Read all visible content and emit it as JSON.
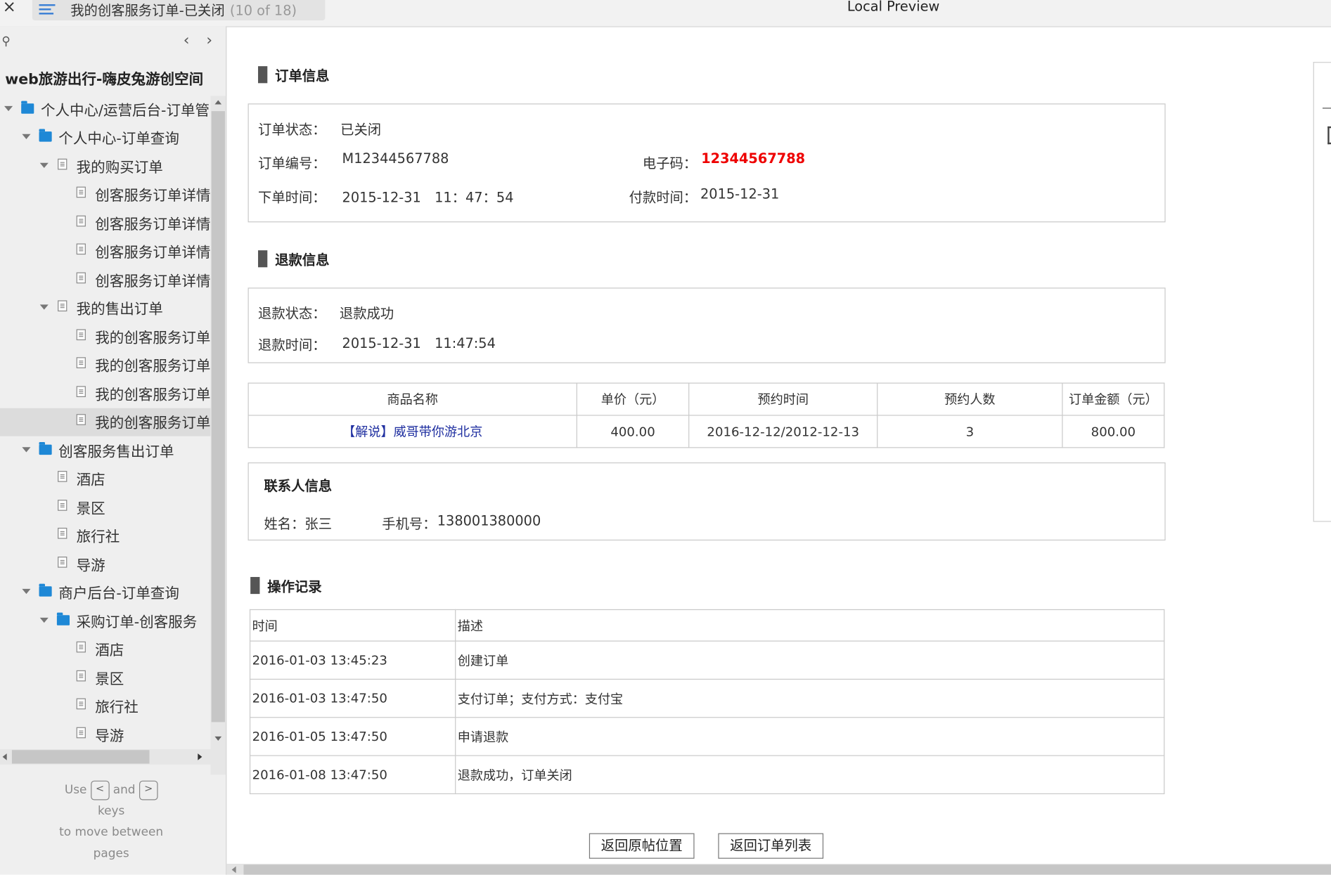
{
  "topbar": {
    "close_glyph": "×",
    "tab_title": "我的创客服务订单-已关闭",
    "tab_count": "(10 of 18)",
    "preview_title": "Local Preview"
  },
  "sidebar": {
    "search_glyph": "⚲",
    "prev_glyph": "‹",
    "next_glyph": "›",
    "project_title": "web旅游出行-嗨皮兔游创空间",
    "tree": [
      {
        "label": "个人中心/运营后台-订单管",
        "type": "folder",
        "expanded": true
      },
      {
        "label": "个人中心-订单查询",
        "type": "folder",
        "expanded": true
      },
      {
        "label": "我的购买订单",
        "type": "page",
        "expanded": true
      },
      {
        "label": "创客服务订单详情",
        "type": "page"
      },
      {
        "label": "创客服务订单详情",
        "type": "page"
      },
      {
        "label": "创客服务订单详情",
        "type": "page"
      },
      {
        "label": "创客服务订单详情",
        "type": "page"
      },
      {
        "label": "我的售出订单",
        "type": "page",
        "expanded": true
      },
      {
        "label": "我的创客服务订单",
        "type": "page"
      },
      {
        "label": "我的创客服务订单",
        "type": "page"
      },
      {
        "label": "我的创客服务订单",
        "type": "page"
      },
      {
        "label": "我的创客服务订单",
        "type": "page",
        "selected": true
      },
      {
        "label": "创客服务售出订单",
        "type": "folder",
        "expanded": true
      },
      {
        "label": "酒店",
        "type": "page"
      },
      {
        "label": "景区",
        "type": "page"
      },
      {
        "label": "旅行社",
        "type": "page"
      },
      {
        "label": "导游",
        "type": "page"
      },
      {
        "label": "商户后台-订单查询",
        "type": "folder",
        "expanded": true
      },
      {
        "label": "采购订单-创客服务",
        "type": "folder",
        "expanded": true
      },
      {
        "label": "酒店",
        "type": "page"
      },
      {
        "label": "景区",
        "type": "page"
      },
      {
        "label": "旅行社",
        "type": "page"
      },
      {
        "label": "导游",
        "type": "page"
      }
    ],
    "hint": {
      "use": "Use",
      "and": "and",
      "keys": "keys",
      "line2": "to move between",
      "line3": "pages",
      "prev_key": "<",
      "next_key": ">"
    }
  },
  "order": {
    "section_title": "订单信息",
    "status_label": "订单状态：",
    "status_value": "已关闭",
    "number_label": "订单编号：",
    "number_value": "M12344567788",
    "ecode_label": "电子码：",
    "ecode_value": "12344567788",
    "time_label": "下单时间：",
    "time_value": "2015-12-31　11：47：54",
    "pay_label": "付款时间：",
    "pay_value": "2015-12-31"
  },
  "refund": {
    "section_title": "退款信息",
    "status_label": "退款状态：",
    "status_value": "退款成功",
    "time_label": "退款时间：",
    "time_value": "2015-12-31　11:47:54"
  },
  "product_table": {
    "headers": [
      "商品名称",
      "单价（元）",
      "预约时间",
      "预约人数",
      "订单金额（元）"
    ],
    "row": [
      "【解说】威哥带你游北京",
      "400.00",
      "2016-12-12/2012-12-13",
      "3",
      "800.00"
    ]
  },
  "contact": {
    "title": "联系人信息",
    "name_label": "姓名：",
    "name_value": "张三",
    "phone_label": "手机号：",
    "phone_value": "138001380000"
  },
  "log": {
    "section_title": "操作记录",
    "headers": [
      "时间",
      "描述"
    ],
    "rows": [
      [
        "2016-01-03  13:45:23",
        "创建订单"
      ],
      [
        "2016-01-03  13:47:50",
        "支付订单；支付方式：支付宝"
      ],
      [
        "2016-01-05  13:47:50",
        "申请退款"
      ],
      [
        "2016-01-08  13:47:50",
        "退款成功，订单关闭"
      ]
    ]
  },
  "buttons": {
    "back_origin": "返回原帖位置",
    "back_list": "返回订单列表"
  },
  "colors": {
    "accent_blue": "#1e88d6",
    "ecode_red": "#e00000",
    "link_blue": "#1f2fa0"
  }
}
